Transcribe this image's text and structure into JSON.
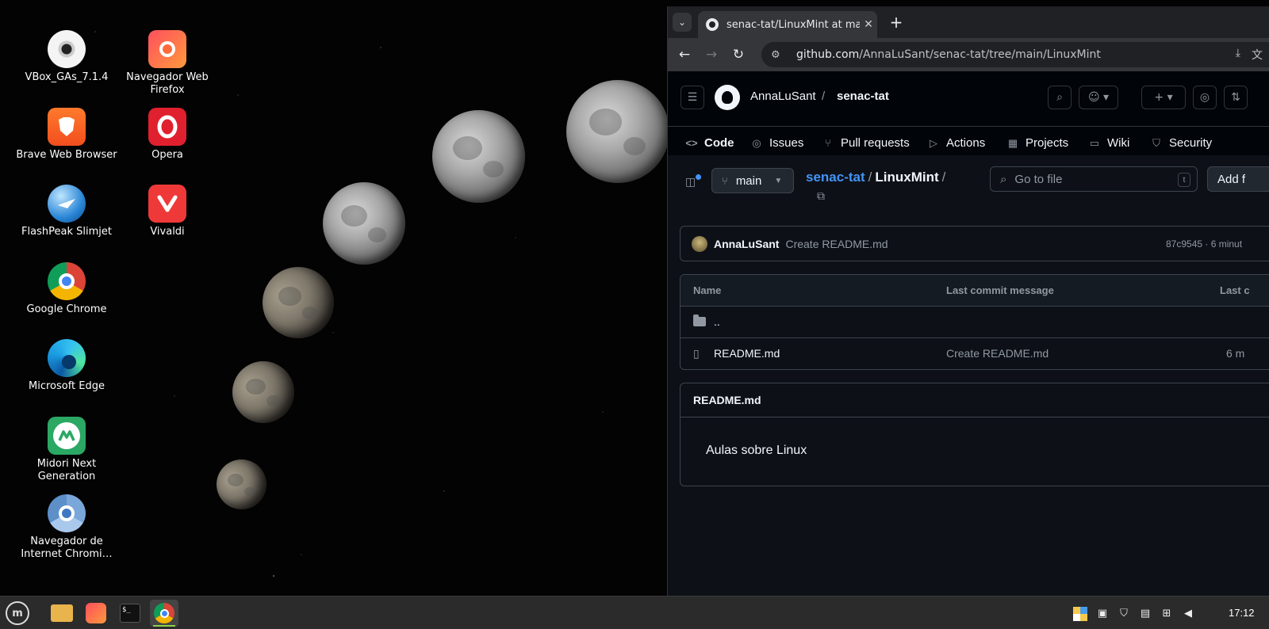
{
  "desktop": {
    "icons": [
      {
        "label": "VBox_GAs_7.1.4",
        "icon": "disc-icon"
      },
      {
        "label": "Navegador Web Firefox",
        "icon": "firefox-icon"
      },
      {
        "label": "Brave Web Browser",
        "icon": "brave-icon"
      },
      {
        "label": "Opera",
        "icon": "opera-icon"
      },
      {
        "label": "FlashPeak Slimjet",
        "icon": "slimjet-icon"
      },
      {
        "label": "Vivaldi",
        "icon": "vivaldi-icon"
      },
      {
        "label": "Google Chrome",
        "icon": "chrome-icon"
      },
      {
        "label": "Microsoft Edge",
        "icon": "edge-icon"
      },
      {
        "label": "Midori Next Generation",
        "icon": "midori-icon"
      },
      {
        "label": "Navegador de Internet Chromi…",
        "icon": "chromium-icon"
      }
    ]
  },
  "browser": {
    "tab_title": "senac-tat/LinuxMint at main",
    "url_host": "github.com",
    "url_path": "/AnnaLuSant/senac-tat/tree/main/LinuxMint"
  },
  "github": {
    "owner": "AnnaLuSant",
    "separator": "/",
    "repo": "senac-tat",
    "tabs": [
      "Code",
      "Issues",
      "Pull requests",
      "Actions",
      "Projects",
      "Wiki",
      "Security"
    ],
    "branch": "main",
    "path_repo": "senac-tat",
    "path_sep": "/",
    "path_dir": "LinuxMint",
    "path_trailing": "/",
    "goto_placeholder": "Go to file",
    "goto_shortcut": "t",
    "add_file": "Add f",
    "commit": {
      "author": "AnnaLuSant",
      "message": "Create README.md",
      "sha_time": "87c9545 · 6 minut"
    },
    "table": {
      "headers": [
        "Name",
        "Last commit message",
        "Last c"
      ],
      "rows": [
        {
          "name": "..",
          "message": "",
          "date": ""
        },
        {
          "name": "README.md",
          "message": "Create README.md",
          "date": "6 m"
        }
      ]
    },
    "readme": {
      "title": "README.md",
      "body": "Aulas sobre Linux"
    }
  },
  "taskbar": {
    "clock": "17:12"
  }
}
